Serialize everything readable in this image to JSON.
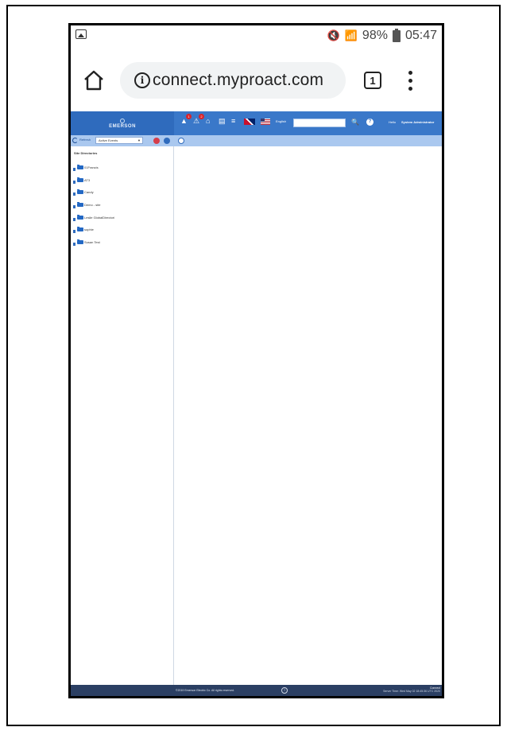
{
  "status_bar": {
    "battery": "98%",
    "time": "05:47",
    "icons": [
      "image-icon",
      "mute-icon",
      "wifi-icon",
      "signal-icon",
      "battery-icon"
    ]
  },
  "browser": {
    "url": "connect.myproact.com",
    "tab_count": "1"
  },
  "app": {
    "brand": "EMERSON",
    "header": {
      "notification_badge": "1",
      "alert_badge": "2",
      "language": "English",
      "search_placeholder": "",
      "hello": "Hello",
      "user": "System Administrator"
    },
    "toolbar": {
      "refresh_label": "Refresh",
      "status_filter": "Active Events"
    },
    "sidebar": {
      "title": "Site Directories",
      "items": [
        {
          "label": "01Francis"
        },
        {
          "label": "AT3"
        },
        {
          "label": "Candy"
        },
        {
          "label": "Demo - site"
        },
        {
          "label": "Leslie GlobalDirectori"
        },
        {
          "label": "sophie"
        },
        {
          "label": "Susan Test"
        }
      ]
    },
    "footer": {
      "copyright": "©2019 Emerson Electric Co. All rights reserved.",
      "brand": "Connect",
      "server_time": "Server Time: Wed May 02 18:45:36 UTC 2020"
    }
  },
  "colors": {
    "header_blue": "#3a78c9",
    "toolbar_blue": "#aac8ef",
    "footer_navy": "#2b3f63",
    "folder_blue": "#2368c4"
  }
}
